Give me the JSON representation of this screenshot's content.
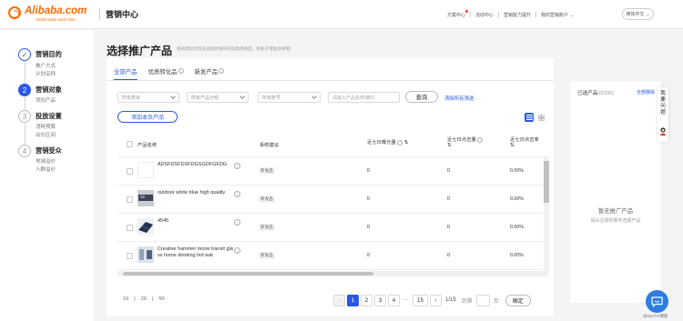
{
  "header": {
    "logo_text": "Alibaba.com",
    "logo_tagline": "Global trade starts here.",
    "product_title": "营销中心",
    "nav": [
      {
        "label": "方案中心",
        "dot": true
      },
      {
        "label": "活动中心",
        "dot": false
      },
      {
        "label": "营销能力提升",
        "dot": false
      },
      {
        "label": "我的营销账户",
        "dot": false
      }
    ],
    "language": "简体中文"
  },
  "steps": [
    {
      "num": "✓",
      "title": "营销目的",
      "subs": [
        "推广方式",
        "计划名称"
      ],
      "state": "done"
    },
    {
      "num": "2",
      "title": "营销对象",
      "subs": [
        "添加产品"
      ],
      "state": "active"
    },
    {
      "num": "3",
      "title": "投放设置",
      "subs": [
        "消耗预算",
        "出价区间"
      ],
      "state": "todo"
    },
    {
      "num": "4",
      "title": "营销受众",
      "subs": [
        "地域溢价",
        "人群溢价"
      ],
      "state": "todo"
    }
  ],
  "main": {
    "title": "选择推广产品",
    "subtitle": "系统建议您优先选择新发布的同类目商品，有助于增加效果哦！",
    "tabs": [
      "全部产品",
      "优质转化品",
      "新发产品"
    ],
    "filters": {
      "category": "所有类目",
      "group": "所有产品分组",
      "account": "所有账号",
      "keyword_placeholder": "请输入产品名称/编ID"
    },
    "search_label": "查询",
    "clear_label": "清除所有筛选",
    "add_page_label": "添加本页产品"
  },
  "table": {
    "headers": [
      "产品名称",
      "系统建议",
      "近七日曝光量",
      "近七日点击量",
      "近七日点击率"
    ],
    "rows": [
      {
        "name": "ADSFDSFDSFDGSGDFGFDG",
        "badge": "新发品",
        "impressions": "0",
        "clicks": "0",
        "ctr": "0.00%"
      },
      {
        "name": "outdoor white blue high quality",
        "badge": "新发品",
        "impressions": "0",
        "clicks": "0",
        "ctr": "0.00%"
      },
      {
        "name": "4545",
        "badge": "新发品",
        "impressions": "0",
        "clicks": "0",
        "ctr": "0.00%"
      },
      {
        "name": "Creative hammer moire transit glass home drinking hot wat",
        "badge": "新发品",
        "impressions": "0",
        "clicks": "0",
        "ctr": "0.00%"
      }
    ]
  },
  "pagination": {
    "sizes": [
      "10",
      "20",
      "50"
    ],
    "pages": [
      "1",
      "2",
      "3",
      "4",
      "15"
    ],
    "ellipsis": "···",
    "current": "1",
    "total": "1/15",
    "goto_label": "到第",
    "page_suffix": "页",
    "confirm_label": "确定"
  },
  "selected_panel": {
    "title": "已选产品",
    "count": "(0/200)",
    "clear_label": "全部移除",
    "empty_title": "暂无推广产品",
    "empty_sub": "请从左侧列表中选择产品"
  },
  "float_panel": {
    "text": "我要问题"
  },
  "watermark": "@51CTO博客",
  "colors": {
    "accent": "#2a58e6",
    "brand": "#ff6a00"
  }
}
